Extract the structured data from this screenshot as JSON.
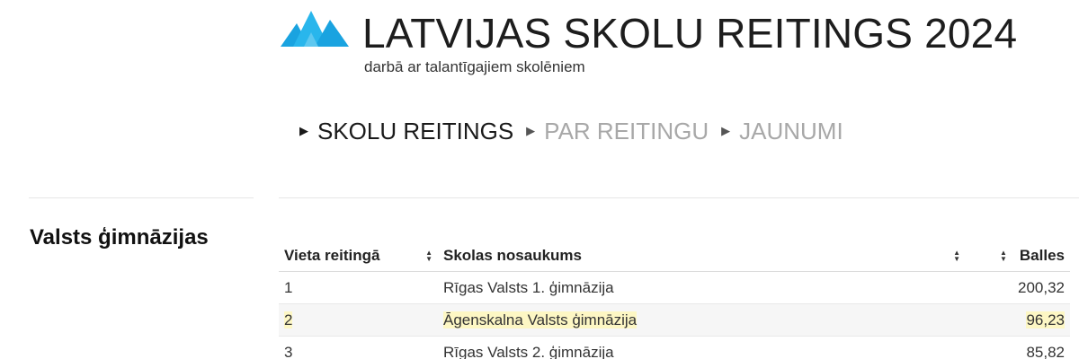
{
  "header": {
    "title": "LATVIJAS SKOLU REITINGS 2024",
    "subtitle": "darbā ar talantīgajiem skolēniem",
    "logo_icon": "mountains-logo-icon",
    "colors": {
      "logo_primary": "#1aa3e0",
      "logo_secondary": "#5ec8f0"
    }
  },
  "nav": {
    "items": [
      {
        "label": "SKOLU REITINGS",
        "active": true
      },
      {
        "label": "PAR REITINGU",
        "active": false
      },
      {
        "label": "JAUNUMI",
        "active": false
      }
    ]
  },
  "section": {
    "heading": "Valsts ģimnāzijas"
  },
  "table": {
    "columns": [
      "Vieta reitingā",
      "Skolas nosaukums",
      "Balles"
    ],
    "rows": [
      {
        "rank": "1",
        "name": "Rīgas Valsts 1. ģimnāzija",
        "score": "200,32",
        "highlighted": false
      },
      {
        "rank": "2",
        "name": "Āgenskalna Valsts ģimnāzija",
        "score": "96,23",
        "highlighted": true
      },
      {
        "rank": "3",
        "name": "Rīgas Valsts 2. ģimnāzija",
        "score": "85,82",
        "highlighted": false
      }
    ],
    "colors": {
      "highlight": "#fdf7c4",
      "row_alt": "#f6f6f6"
    }
  }
}
